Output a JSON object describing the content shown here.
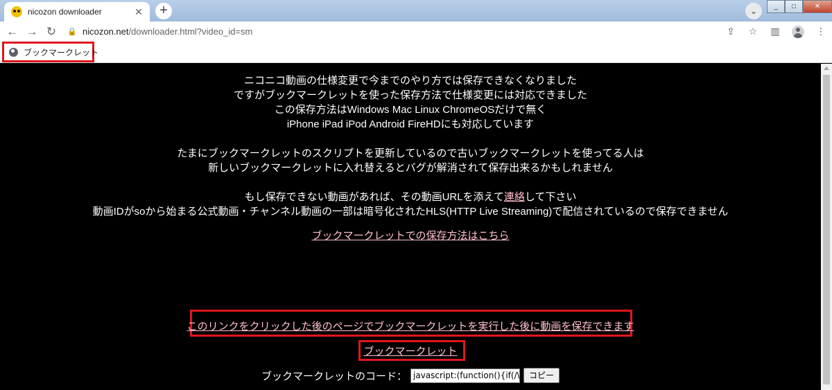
{
  "browser": {
    "tab_title": "nicozon downloader",
    "tab_close": "✕",
    "new_tab": "+",
    "tab_search": "⌄",
    "url_host": "nicozon.net",
    "url_path": "/downloader.html?video_id=sm",
    "win_min": "_",
    "win_max": "□",
    "win_close": "✕"
  },
  "bookmarks": {
    "items": [
      {
        "label": "ブックマークレット"
      }
    ]
  },
  "page": {
    "para1": [
      "ニコニコ動画の仕様変更で今までのやり方では保存できなくなりました",
      "ですがブックマークレットを使った保存方法で仕様変更には対応できました",
      "この保存方法はWindows Mac Linux ChromeOSだけで無く",
      "iPhone iPad iPod Android FireHDにも対応しています"
    ],
    "para2": [
      "たまにブックマークレットのスクリプトを更新しているので古いブックマークレットを使ってる人は",
      "新しいブックマークレットに入れ替えるとバグが解消されて保存出来るかもしれません"
    ],
    "para3_line1_before": "もし保存できない動画があれば、その動画URLを添えて",
    "para3_line1_link": "連絡",
    "para3_line1_after": "して下さい",
    "para3_line2": "動画IDがsoから始まる公式動画・チャンネル動画の一部は暗号化されたHLS(HTTP Live Streaming)で配信されているので保存できません",
    "howto_link": "ブックマークレットでの保存方法はこちら",
    "click_link": "このリンクをクリックした後のページでブックマークレットを実行した後に動画を保存できます",
    "bookmarklet_link": "ブックマークレット",
    "code_label": "ブックマークレットのコード：",
    "code_value": "javascript:(function(){if(/\\.nicc",
    "copy_label": "コピー"
  },
  "colors": {
    "page_bg": "#000000",
    "text": "#ffffff",
    "link": "#ffc0cb",
    "highlight_box": "#e0161b"
  }
}
